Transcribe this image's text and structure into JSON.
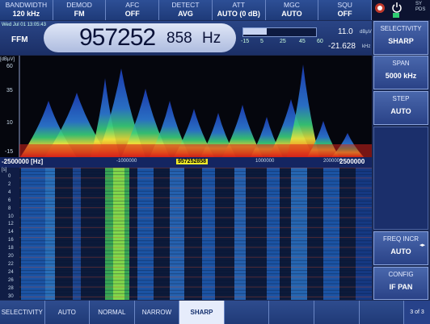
{
  "top_bar": [
    {
      "label": "BANDWIDTH",
      "value": "120 kHz"
    },
    {
      "label": "DEMOD",
      "value": "FM"
    },
    {
      "label": "AFC",
      "value": "OFF"
    },
    {
      "label": "DETECT",
      "value": "AVG"
    },
    {
      "label": "ATT",
      "value": "AUTO (0 dB)"
    },
    {
      "label": "MGC",
      "value": "AUTO"
    },
    {
      "label": "SQU",
      "value": "OFF"
    }
  ],
  "top_right_text": "SY\nPDS",
  "freq_panel": {
    "date": "Wed Jul 01  13:05:43",
    "mode": "FFM",
    "freq_main": "957252",
    "freq_sub": "858",
    "freq_unit": "Hz",
    "level_value": "11.0",
    "level_unit": "dBµV",
    "offset_value": "-21.628",
    "offset_unit": "kHz",
    "scale": [
      "-15",
      "5",
      "25",
      "45",
      "60"
    ],
    "level_fraction": 0.33
  },
  "spectrum": {
    "y_unit": "[dBµV]",
    "y_ticks": [
      "60",
      "35",
      "10",
      "-15"
    ],
    "x_left": "-2500000 [Hz]",
    "x_ticks": [
      "-1000000",
      "1000000",
      "2000000"
    ],
    "x_right": "2500000",
    "marker": "957252858"
  },
  "waterfall": {
    "unit": "[s]",
    "y_ticks": [
      "0",
      "2",
      "4",
      "6",
      "8",
      "10",
      "12",
      "14",
      "16",
      "18",
      "20",
      "22",
      "24",
      "26",
      "28",
      "30"
    ]
  },
  "right_panel": [
    {
      "title": "SELECTIVITY",
      "value": "SHARP"
    },
    {
      "title": "SPAN",
      "value": "5000 kHz"
    },
    {
      "title": "STEP",
      "value": "AUTO"
    },
    {
      "title": "FREQ INCR",
      "value": "AUTO"
    },
    {
      "title": "CONFIG",
      "value": "IF PAN"
    }
  ],
  "bottom_bar": [
    "SELECTIVITY",
    "AUTO",
    "NORMAL",
    "NARROW",
    "SHARP",
    "",
    "",
    "",
    ""
  ],
  "bottom_selected": "SHARP",
  "page_indicator": "3 of 3",
  "colors": {
    "accent": "#2a4287",
    "marker": "#f4ec2a"
  }
}
